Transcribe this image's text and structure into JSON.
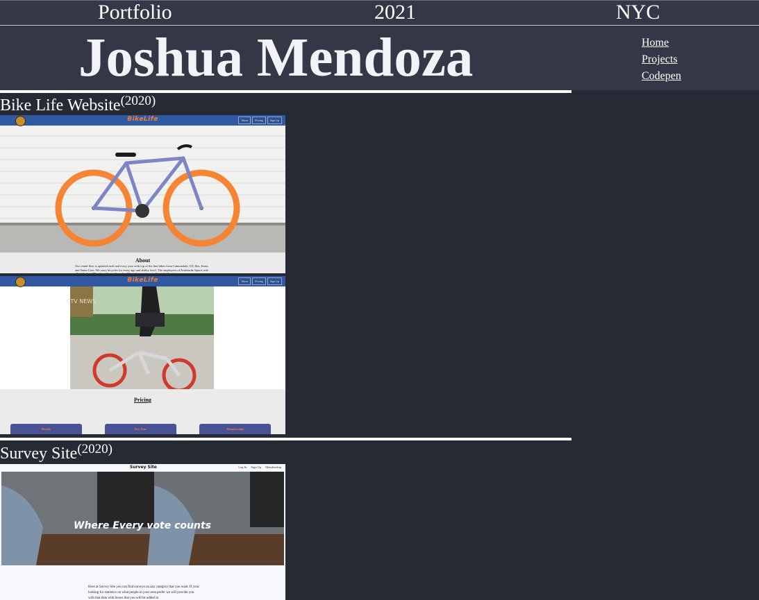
{
  "topbar": {
    "label": "Portfolio",
    "year": "2021",
    "city": "NYC"
  },
  "header": {
    "name": "Joshua Mendoza"
  },
  "nav": {
    "items": [
      "Home",
      "Projects",
      "Codepen"
    ]
  },
  "projects": [
    {
      "title": "Bike Life Website",
      "year": "(2020)",
      "brand": "BikeLife",
      "nav_buttons": [
        "About",
        "Pricing",
        "Sign Up"
      ],
      "about_title": "About",
      "about_text": "Our rental fleet is updated each and every year with top of the line bikes from Cannondale, GT, Ibis, Kona, and Santa Cruz. We carry bicycles for every age and ability level. The employees of Avalanche Sports ride all of the local Breckenridge trails and will happily point you in the right direction.",
      "pricing_title": "Pricing",
      "price_buttons": [
        "Hourly",
        "Day Pass",
        "Membership"
      ],
      "photo_badge": "CTV NEWS"
    },
    {
      "title": "Survey Site",
      "year": "(2020)",
      "brand": "Survey Site",
      "nav_links": [
        "Log In",
        "Sign Up",
        "Membership"
      ],
      "hero_text": "Where Every vote counts",
      "body_text": "Here at Survey Site you can find surveys on any category that you want. If your looking for statistics on what people in your area prefer we will provide you with that data with boxes that you will be added in"
    }
  ],
  "colors": {
    "background": "#262a35",
    "header": "#343846",
    "bike_nav": "#3059a2",
    "bike_accent": "#f57d30",
    "price_button": "#4a5296"
  }
}
